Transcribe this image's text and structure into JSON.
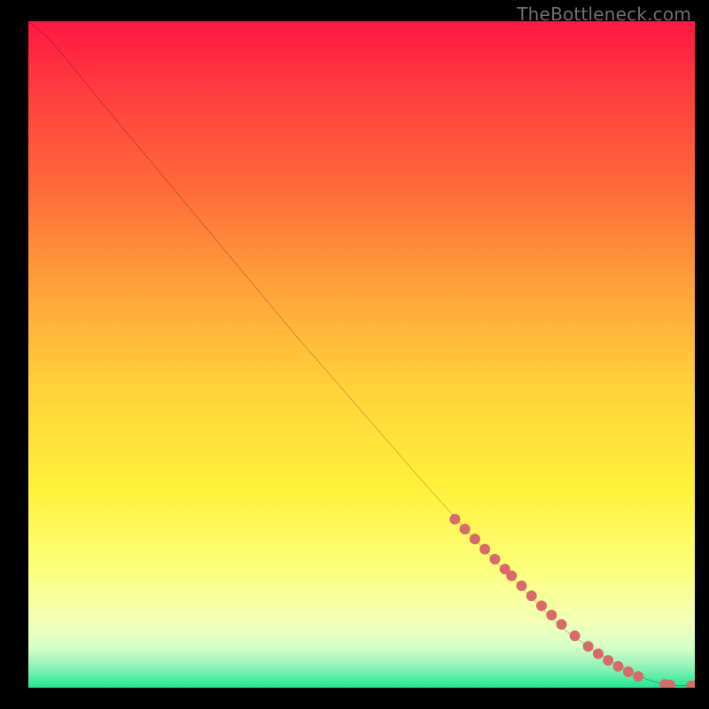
{
  "watermark": "TheBottleneck.com",
  "chart_data": {
    "type": "line",
    "title": "",
    "xlabel": "",
    "ylabel": "",
    "xlim": [
      0,
      100
    ],
    "ylim": [
      0,
      100
    ],
    "grid": false,
    "legend": false,
    "background_gradient": {
      "direction": "vertical",
      "stops": [
        {
          "pos": 0.0,
          "color": "#ff1744"
        },
        {
          "pos": 0.1,
          "color": "#ff3b3f"
        },
        {
          "pos": 0.25,
          "color": "#ff6a3a"
        },
        {
          "pos": 0.4,
          "color": "#ffa23a"
        },
        {
          "pos": 0.55,
          "color": "#ffd23a"
        },
        {
          "pos": 0.7,
          "color": "#fff13a"
        },
        {
          "pos": 0.82,
          "color": "#fcff7a"
        },
        {
          "pos": 0.9,
          "color": "#f3ffb8"
        },
        {
          "pos": 0.94,
          "color": "#d5ffc8"
        },
        {
          "pos": 0.97,
          "color": "#8cf2b8"
        },
        {
          "pos": 1.0,
          "color": "#1ee890"
        }
      ]
    },
    "series": [
      {
        "name": "curve",
        "color": "#000000",
        "width": 2,
        "x": [
          0,
          3,
          6,
          10,
          15,
          20,
          30,
          40,
          50,
          60,
          70,
          80,
          85,
          90,
          93,
          95,
          97,
          100
        ],
        "y": [
          100,
          97.5,
          94,
          89,
          83,
          77,
          65,
          53,
          41.5,
          30,
          19,
          9,
          5.5,
          2.5,
          1.2,
          0.6,
          0.3,
          0.3
        ]
      }
    ],
    "points": {
      "name": "markers",
      "color": "#d96a6a",
      "radius_px": 6,
      "x": [
        64,
        65.5,
        67,
        68.5,
        70,
        71.5,
        72.5,
        74,
        75.5,
        77,
        78.5,
        80,
        82,
        84,
        85.5,
        87,
        88.5,
        90,
        91.5,
        95.5,
        96.3,
        99.5,
        100
      ],
      "y": [
        25.3,
        23.8,
        22.3,
        20.8,
        19.3,
        17.8,
        16.8,
        15.3,
        13.8,
        12.3,
        10.9,
        9.5,
        7.8,
        6.2,
        5.1,
        4.1,
        3.2,
        2.4,
        1.7,
        0.5,
        0.4,
        0.3,
        0.3
      ]
    }
  }
}
